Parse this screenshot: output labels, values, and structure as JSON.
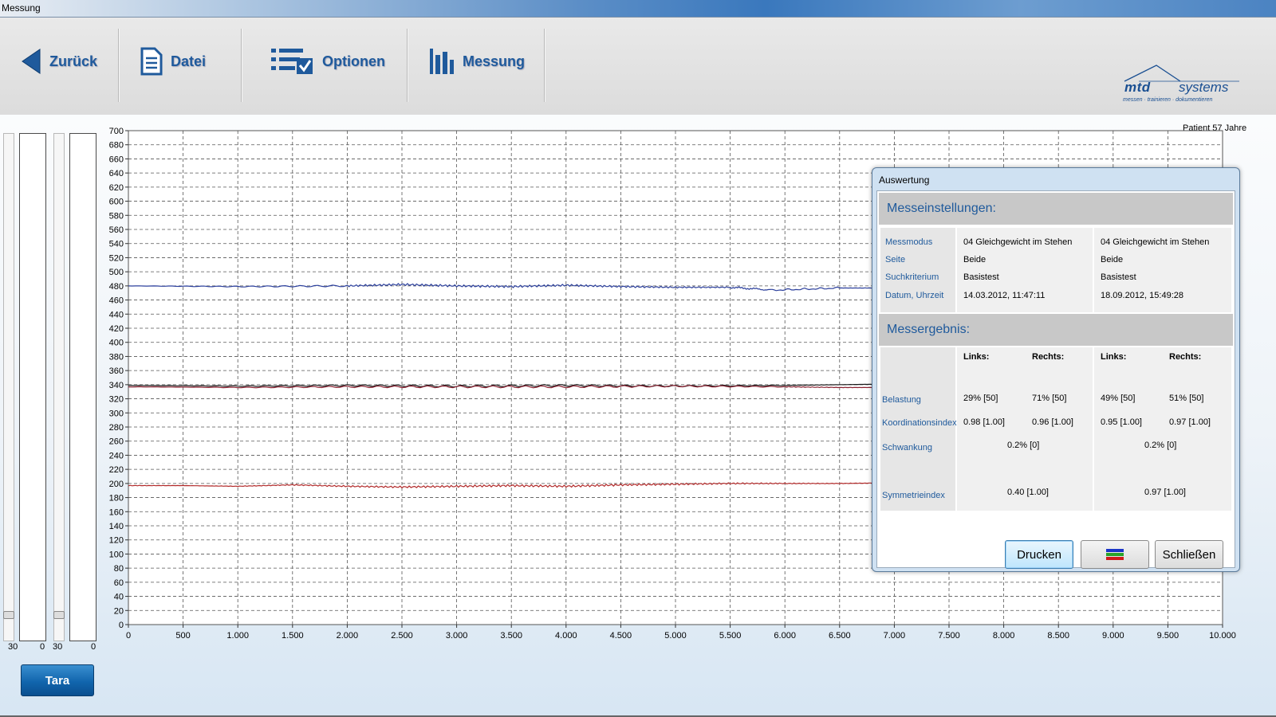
{
  "window": {
    "title": "Messung"
  },
  "toolbar": {
    "back_label": "Zurück",
    "file_label": "Datei",
    "options_label": "Optionen",
    "measure_label": "Messung",
    "logo_name": "mtd",
    "logo_name2": "systems",
    "logo_tagline": "messen · trainieren · dokumentieren"
  },
  "sliders": {
    "left": {
      "max_label": "30",
      "min_label": "0",
      "level_fraction": 0.95
    },
    "right": {
      "max_label": "30",
      "min_label": "0",
      "level_fraction": 0.95
    }
  },
  "tara_label": "Tara",
  "patient_label": "Patient 57 Jahre",
  "chart_data": {
    "type": "line",
    "xlim": [
      0,
      10000
    ],
    "ylim": [
      0,
      700
    ],
    "x_ticks": [
      "0",
      "500",
      "1.000",
      "1.500",
      "2.000",
      "2.500",
      "3.000",
      "3.500",
      "4.000",
      "4.500",
      "5.000",
      "5.500",
      "6.000",
      "6.500",
      "7.000",
      "7.500",
      "8.000",
      "8.500",
      "9.000",
      "9.500",
      "10.000"
    ],
    "y_ticks": [
      "0",
      "20",
      "40",
      "60",
      "80",
      "100",
      "120",
      "140",
      "160",
      "180",
      "200",
      "220",
      "240",
      "260",
      "280",
      "300",
      "320",
      "340",
      "360",
      "380",
      "400",
      "420",
      "440",
      "460",
      "480",
      "500",
      "520",
      "540",
      "560",
      "580",
      "600",
      "620",
      "640",
      "660",
      "680",
      "700"
    ],
    "grid": true,
    "series": [
      {
        "color": "#2b3f9c",
        "x": [
          0,
          1000,
          2000,
          2500,
          3000,
          3500,
          4000,
          4500,
          5000,
          5500,
          5900,
          6500,
          7000,
          8000,
          9000,
          10000
        ],
        "values": [
          480,
          479,
          480,
          482,
          480,
          479,
          481,
          479,
          478,
          478,
          474,
          477,
          477,
          477,
          477,
          477
        ]
      },
      {
        "color": "#1a1a1a",
        "x": [
          0,
          1000,
          2000,
          3000,
          4000,
          5000,
          6000,
          6500,
          7000,
          8000,
          9000,
          10000
        ],
        "values": [
          339,
          338,
          339,
          338,
          339,
          338,
          339,
          340,
          341,
          341,
          341,
          341
        ]
      },
      {
        "color": "#8a2030",
        "x": [
          0,
          1000,
          2000,
          3000,
          4000,
          5000,
          6000,
          6500,
          7000,
          8000,
          9000,
          10000
        ],
        "values": [
          337,
          336,
          337,
          337,
          337,
          338,
          337,
          336,
          336,
          336,
          336,
          336
        ]
      },
      {
        "color": "#b22a2a",
        "x": [
          0,
          500,
          1000,
          1500,
          2000,
          2500,
          3000,
          3500,
          4000,
          4500,
          5000,
          5500,
          6000,
          6500,
          7000,
          8000,
          9000,
          10000
        ],
        "values": [
          197,
          197,
          196,
          198,
          196,
          195,
          196,
          197,
          196,
          198,
          199,
          200,
          200,
          200,
          201,
          201,
          201,
          201
        ]
      }
    ]
  },
  "dialog": {
    "title": "Auswertung",
    "settings_heading": "Messeinstellungen:",
    "settings_labels": [
      "Messmodus",
      "Seite",
      "Suchkriterium",
      "Datum, Uhrzeit"
    ],
    "settings_col1": [
      "04 Gleichgewicht im Stehen",
      "Beide",
      "Basistest",
      "14.03.2012, 11:47:11"
    ],
    "settings_col2": [
      "04 Gleichgewicht im Stehen",
      "Beide",
      "Basistest",
      "18.09.2012, 15:49:28"
    ],
    "results_heading": "Messergebnis:",
    "results_headers": {
      "left": "Links:",
      "right": "Rechts:"
    },
    "results_labels": [
      "Belastung",
      "Koordinationsindex",
      "Schwankung",
      "Symmetrieindex"
    ],
    "col1": {
      "belastung_l": "29% [50]",
      "belastung_r": "71% [50]",
      "koord_l": "0.98 [1.00]",
      "koord_r": "0.96 [1.00]",
      "schwankung": "0.2% [0]",
      "symmetrie": "0.40 [1.00]"
    },
    "col2": {
      "belastung_l": "49% [50]",
      "belastung_r": "51% [50]",
      "koord_l": "0.95 [1.00]",
      "koord_r": "0.97 [1.00]",
      "schwankung": "0.2% [0]",
      "symmetrie": "0.97 [1.00]"
    },
    "print_label": "Drucken",
    "color_icon": "color-bars-icon",
    "close_label": "Schließen"
  }
}
